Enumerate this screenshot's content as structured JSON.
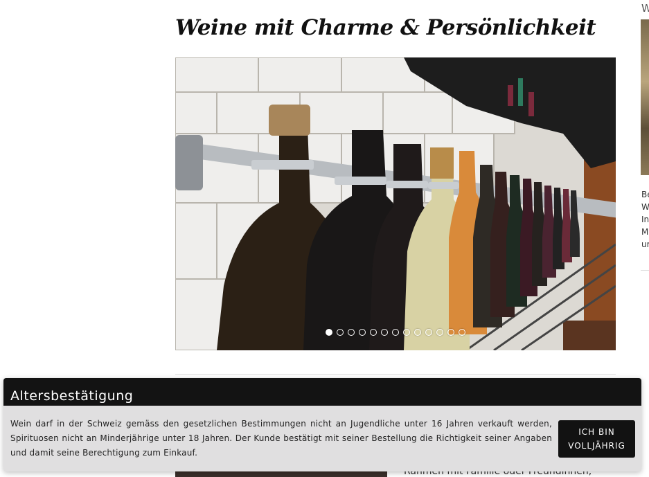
{
  "page": {
    "title": "Weine mit Charme & Persönlichkeit"
  },
  "slider": {
    "dot_count": 13,
    "active_index": 0,
    "image_alt": "wine-bottles-on-wall-rack"
  },
  "sidebar": {
    "heading": "W",
    "text_lines": [
      "Be",
      "W",
      "In",
      "M",
      "ur"
    ]
  },
  "content": {
    "partial_text": "Rahmen mit Familie oder Freundinnen,"
  },
  "age_verification": {
    "title": "Altersbestätigung",
    "message": "Wein darf in der Schweiz gemäss den gesetzlichen Bestimmungen nicht an Jugendliche unter 16 Jahren verkauft werden, Spirituosen nicht an Minderjährige unter 18 Jahren. Der Kunde bestätigt mit seiner Bestellung die Richtigkeit seiner Angaben und damit seine Berechtigung zum Einkauf.",
    "button_line1": "ICH BIN",
    "button_line2": "VOLLJÄHRIG"
  },
  "colors": {
    "banner_header": "#131313",
    "banner_body": "#e0dfe0",
    "button": "#121212"
  }
}
